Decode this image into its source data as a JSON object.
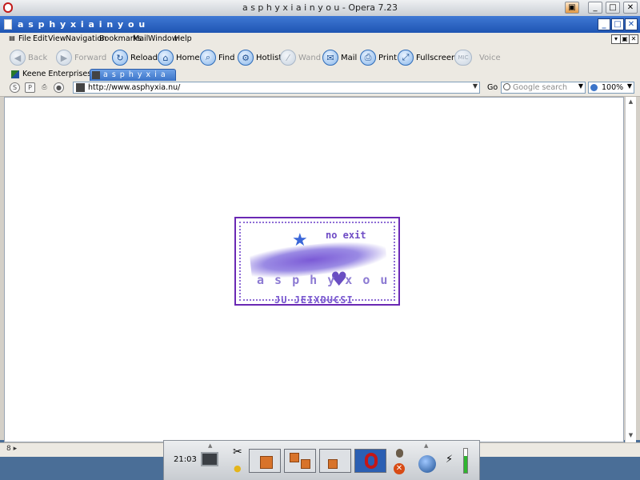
{
  "os_window": {
    "title": "a s p h y x i a i n y o u - Opera 7.23"
  },
  "browser": {
    "window_title": "a s p h y x i a i n y o u",
    "menu": [
      "File",
      "Edit",
      "View",
      "Navigation",
      "Bookmarks",
      "Mail",
      "Window",
      "Help"
    ],
    "toolbar": {
      "back": "Back",
      "forward": "Forward",
      "reload": "Reload",
      "home": "Home",
      "find": "Find",
      "hotlist": "Hotlist",
      "wand": "Wand",
      "mail": "Mail",
      "print": "Print",
      "fullscreen": "Fullscreen",
      "voice": "Voice"
    },
    "tabs": [
      {
        "label": "Keene Enterprises",
        "active": false
      },
      {
        "label": "a s p h y x i a i n y ...",
        "active": true
      }
    ],
    "address": {
      "url": "http://www.asphyxia.nu/",
      "go_label": "Go",
      "search_placeholder": "Google search",
      "zoom": "100%"
    }
  },
  "page": {
    "stamp": {
      "line1": "no exit",
      "line2": "a s p h y x   o u",
      "line3": "JU JEIXDUCSI"
    }
  },
  "taskbar": {
    "clock": "21:03"
  },
  "colors": {
    "desktop": "#4a6e97",
    "title_blue": "#1f55b3",
    "stamp_purple": "#6a28b4"
  }
}
